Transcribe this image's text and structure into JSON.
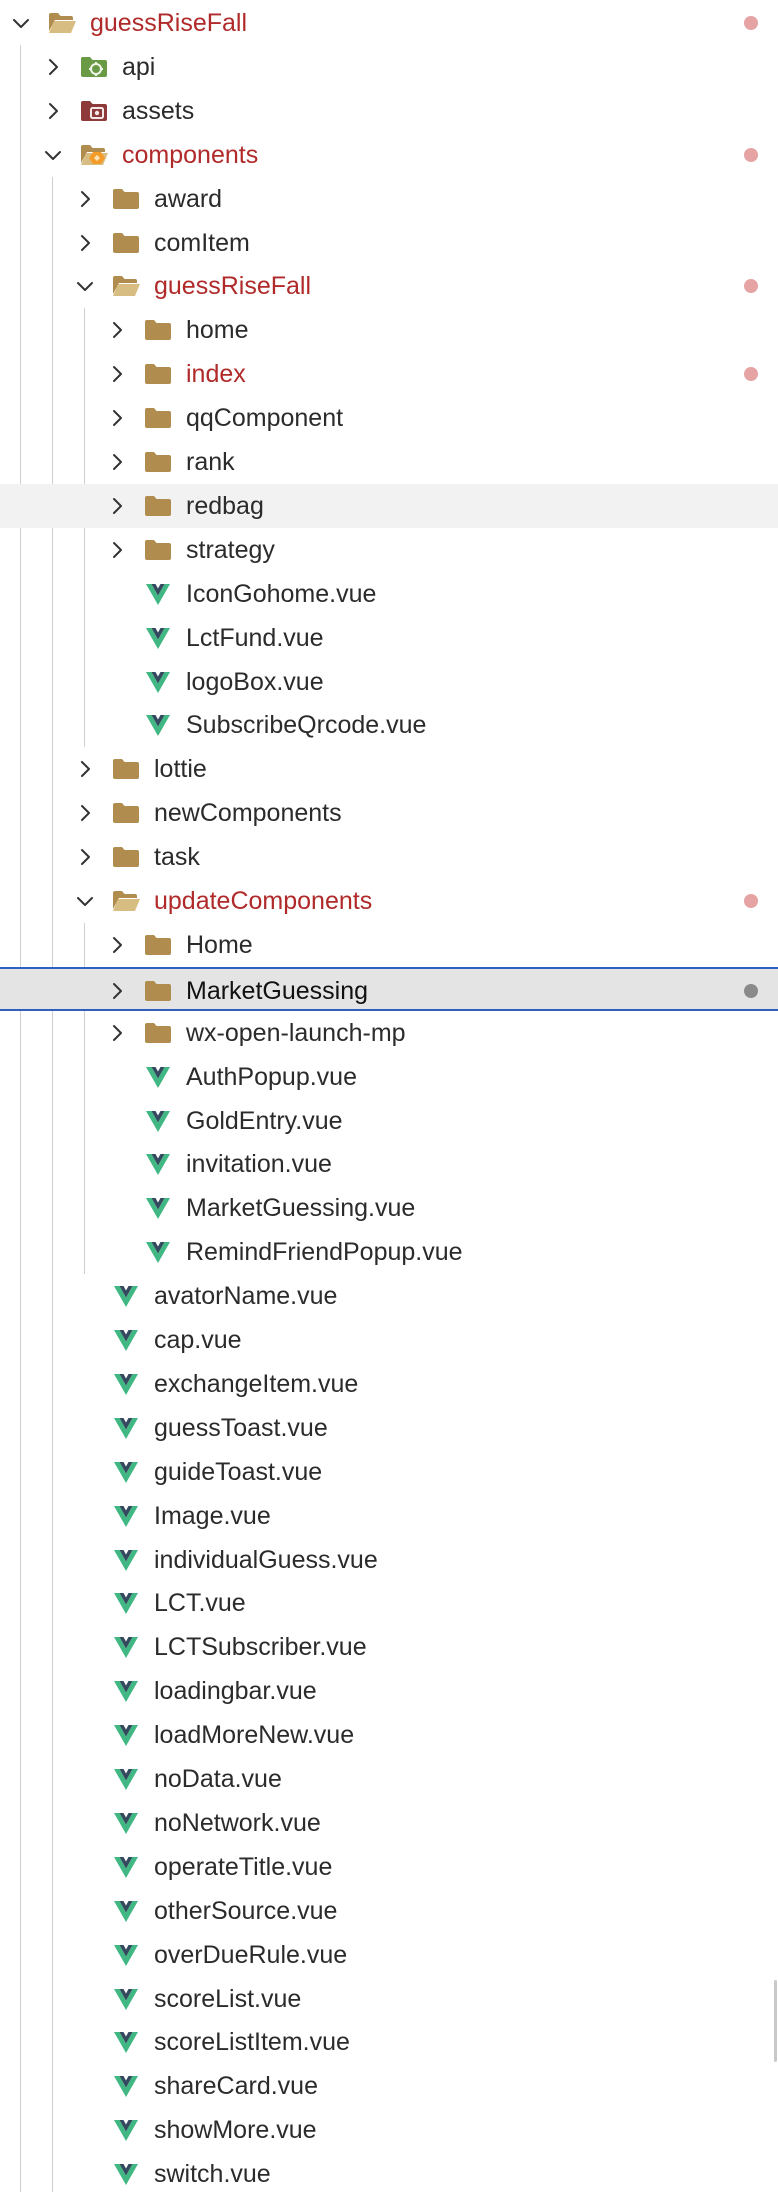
{
  "explorer": {
    "rows": [
      {
        "label": "guessRiseFall",
        "depth": 0,
        "type": "folder-open",
        "expanded": true,
        "modified": true
      },
      {
        "label": "api",
        "depth": 1,
        "type": "folder-api",
        "expanded": false
      },
      {
        "label": "assets",
        "depth": 1,
        "type": "folder-assets",
        "expanded": false
      },
      {
        "label": "components",
        "depth": 1,
        "type": "folder-components",
        "expanded": true,
        "modified": true
      },
      {
        "label": "award",
        "depth": 2,
        "type": "folder",
        "expanded": false
      },
      {
        "label": "comItem",
        "depth": 2,
        "type": "folder",
        "expanded": false
      },
      {
        "label": "guessRiseFall",
        "depth": 2,
        "type": "folder-open",
        "expanded": true,
        "modified": true
      },
      {
        "label": "home",
        "depth": 3,
        "type": "folder",
        "expanded": false
      },
      {
        "label": "index",
        "depth": 3,
        "type": "folder",
        "expanded": false,
        "modified": true
      },
      {
        "label": "qqComponent",
        "depth": 3,
        "type": "folder",
        "expanded": false
      },
      {
        "label": "rank",
        "depth": 3,
        "type": "folder",
        "expanded": false
      },
      {
        "label": "redbag",
        "depth": 3,
        "type": "folder",
        "expanded": false,
        "hover": true
      },
      {
        "label": "strategy",
        "depth": 3,
        "type": "folder",
        "expanded": false
      },
      {
        "label": "IconGohome.vue",
        "depth": 3,
        "type": "vue"
      },
      {
        "label": "LctFund.vue",
        "depth": 3,
        "type": "vue"
      },
      {
        "label": "logoBox.vue",
        "depth": 3,
        "type": "vue"
      },
      {
        "label": "SubscribeQrcode.vue",
        "depth": 3,
        "type": "vue"
      },
      {
        "label": "lottie",
        "depth": 2,
        "type": "folder",
        "expanded": false
      },
      {
        "label": "newComponents",
        "depth": 2,
        "type": "folder",
        "expanded": false
      },
      {
        "label": "task",
        "depth": 2,
        "type": "folder",
        "expanded": false
      },
      {
        "label": "updateComponents",
        "depth": 2,
        "type": "folder-open",
        "expanded": true,
        "modified": true
      },
      {
        "label": "Home",
        "depth": 3,
        "type": "folder",
        "expanded": false
      },
      {
        "label": "MarketGuessing",
        "depth": 3,
        "type": "folder",
        "expanded": false,
        "selected": true,
        "gray_dot": true
      },
      {
        "label": "wx-open-launch-mp",
        "depth": 3,
        "type": "folder",
        "expanded": false
      },
      {
        "label": "AuthPopup.vue",
        "depth": 3,
        "type": "vue"
      },
      {
        "label": "GoldEntry.vue",
        "depth": 3,
        "type": "vue"
      },
      {
        "label": "invitation.vue",
        "depth": 3,
        "type": "vue"
      },
      {
        "label": "MarketGuessing.vue",
        "depth": 3,
        "type": "vue"
      },
      {
        "label": "RemindFriendPopup.vue",
        "depth": 3,
        "type": "vue"
      },
      {
        "label": "avatorName.vue",
        "depth": 2,
        "type": "vue"
      },
      {
        "label": "cap.vue",
        "depth": 2,
        "type": "vue"
      },
      {
        "label": "exchangeItem.vue",
        "depth": 2,
        "type": "vue"
      },
      {
        "label": "guessToast.vue",
        "depth": 2,
        "type": "vue"
      },
      {
        "label": "guideToast.vue",
        "depth": 2,
        "type": "vue"
      },
      {
        "label": "Image.vue",
        "depth": 2,
        "type": "vue"
      },
      {
        "label": "individualGuess.vue",
        "depth": 2,
        "type": "vue"
      },
      {
        "label": "LCT.vue",
        "depth": 2,
        "type": "vue"
      },
      {
        "label": "LCTSubscriber.vue",
        "depth": 2,
        "type": "vue"
      },
      {
        "label": "loadingbar.vue",
        "depth": 2,
        "type": "vue"
      },
      {
        "label": "loadMoreNew.vue",
        "depth": 2,
        "type": "vue"
      },
      {
        "label": "noData.vue",
        "depth": 2,
        "type": "vue"
      },
      {
        "label": "noNetwork.vue",
        "depth": 2,
        "type": "vue"
      },
      {
        "label": "operateTitle.vue",
        "depth": 2,
        "type": "vue"
      },
      {
        "label": "otherSource.vue",
        "depth": 2,
        "type": "vue"
      },
      {
        "label": "overDueRule.vue",
        "depth": 2,
        "type": "vue"
      },
      {
        "label": "scoreList.vue",
        "depth": 2,
        "type": "vue"
      },
      {
        "label": "scoreListItem.vue",
        "depth": 2,
        "type": "vue"
      },
      {
        "label": "shareCard.vue",
        "depth": 2,
        "type": "vue"
      },
      {
        "label": "showMore.vue",
        "depth": 2,
        "type": "vue"
      },
      {
        "label": "switch.vue",
        "depth": 2,
        "type": "vue"
      }
    ]
  },
  "colors": {
    "modified_text": "#b02a2a",
    "modified_dot": "#e5a3a3",
    "folder": "#b08d4f",
    "vue_green": "#41b883",
    "vue_dark": "#35495e",
    "selection_border": "#2f5fbf"
  },
  "icons": {
    "folder": "folder-icon",
    "folder-open": "folder-open-icon",
    "folder-api": "api-folder-icon",
    "folder-assets": "assets-folder-icon",
    "folder-components": "components-folder-icon",
    "vue": "vue-file-icon",
    "chevron-right": "chevron-right-icon",
    "chevron-down": "chevron-down-icon"
  }
}
